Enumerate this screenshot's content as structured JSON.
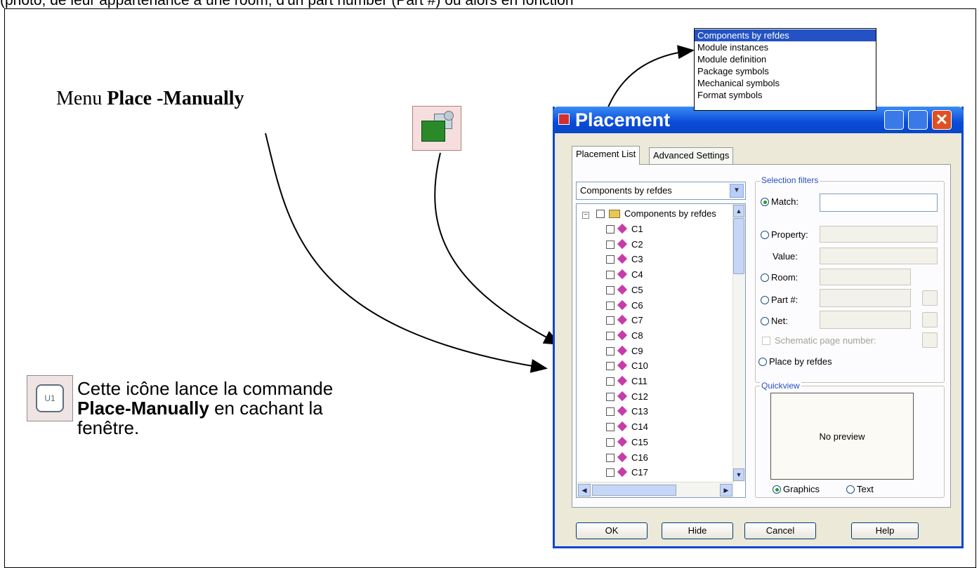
{
  "top_caption": "(photo, de leur appartenance à une room, d'un part number (Part #) ou alors en fonction",
  "annotations": {
    "menu_prefix": "Menu",
    "menu_bold": "Place -Manually",
    "note_line1": "Cette icône lance la commande",
    "note_bold": "Place-Manually",
    "note_line2_rest": " en cachant la",
    "note_line3": "fenêtre.",
    "left_icon_text": "U1"
  },
  "dropdown_list": {
    "items": [
      "Components by refdes",
      "Module instances",
      "Module definition",
      "Package symbols",
      "Mechanical symbols",
      "Format symbols"
    ],
    "selected_index": 0
  },
  "dialog": {
    "title": "Placement",
    "close_glyph": "✕",
    "tabs": [
      "Placement List",
      "Advanced Settings"
    ],
    "combo_value": "Components by refdes",
    "tree_root": "Components by refdes",
    "tree_items": [
      "C1",
      "C2",
      "C3",
      "C4",
      "C5",
      "C6",
      "C7",
      "C8",
      "C9",
      "C10",
      "C11",
      "C12",
      "C13",
      "C14",
      "C15",
      "C16",
      "C17"
    ],
    "selection_filters": {
      "legend": "Selection filters",
      "match_label": "Match:",
      "match_value": "",
      "property_label": "Property:",
      "value_label": "Value:",
      "room_label": "Room:",
      "part_label": "Part #:",
      "net_label": "Net:",
      "schematic_label": "Schematic page number:",
      "place_by_refdes_label": "Place by refdes"
    },
    "quick_view": {
      "legend": "Quickview",
      "preview_text": "No preview",
      "graphics_label": "Graphics",
      "text_label": "Text"
    },
    "buttons": {
      "ok": "OK",
      "hide": "Hide",
      "cancel": "Cancel",
      "help": "Help"
    }
  },
  "colors": {
    "titlebar": "#0a4ad8",
    "selection": "#2452c4",
    "close_button": "#e05020"
  }
}
